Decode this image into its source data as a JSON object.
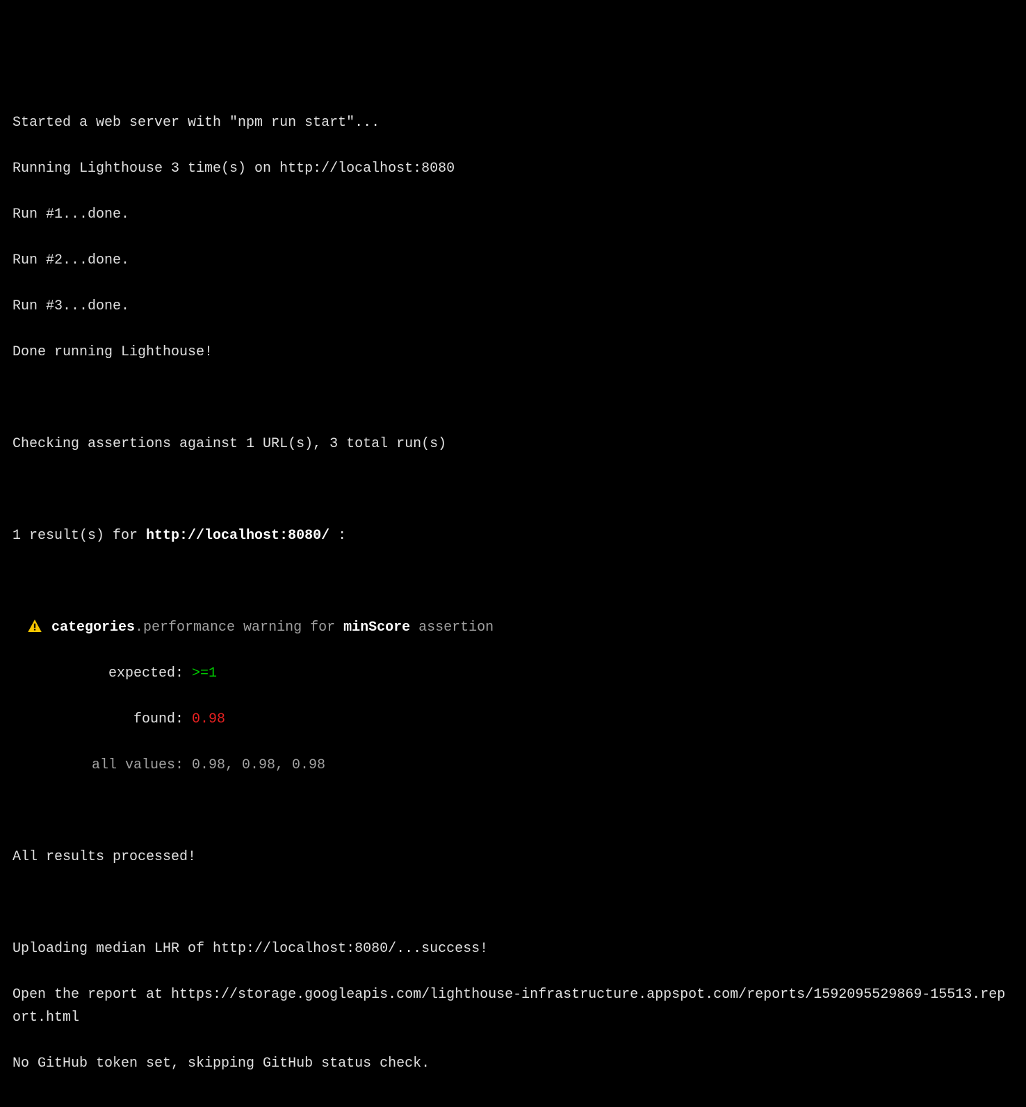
{
  "log": {
    "started": "Started a web server with \"npm run start\"...",
    "running": "Running Lighthouse 3 time(s) on http://localhost:8080",
    "run1": "Run #1...done.",
    "run2": "Run #2...done.",
    "run3": "Run #3...done.",
    "done_running": "Done running Lighthouse!",
    "checking": "Checking assertions against 1 URL(s), 3 total run(s)",
    "results_prefix": "1 result(s) for ",
    "results_url": "http://localhost:8080/",
    "results_suffix": " :",
    "assertion": {
      "category_key": "categories",
      "category_rest": ".performance warning for ",
      "metric": "minScore",
      "metric_suffix": " assertion",
      "expected_label": "expected:",
      "expected_value": ">=1",
      "found_label": "found:",
      "found_value": "0.98",
      "all_values_label": "all values:",
      "all_values_value": "0.98, 0.98, 0.98"
    },
    "processed": "All results processed!",
    "uploading": "Uploading median LHR of http://localhost:8080/...success!",
    "open_report": "Open the report at https://storage.googleapis.com/lighthouse-infrastructure.appspot.com/reports/1592095529869-15513.report.html",
    "no_token": "No GitHub token set, skipping GitHub status check."
  }
}
